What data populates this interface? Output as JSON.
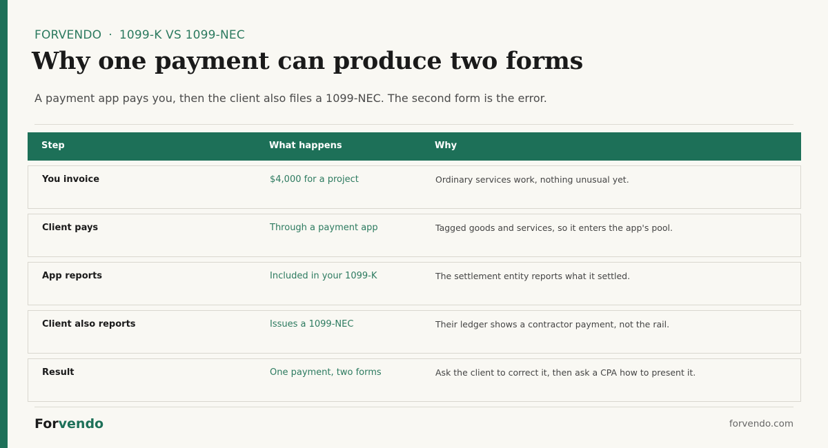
{
  "eyebrow": {
    "brand": "FORVENDO",
    "separator": "·",
    "topic": "1099-K VS 1099-NEC"
  },
  "title": "Why one payment can produce two forms",
  "subtitle": "A payment app pays you, then the client also files a 1099-NEC. The second form is the error.",
  "table": {
    "headers": [
      "Step",
      "What happens",
      "Why"
    ],
    "rows": [
      {
        "step": "You invoice",
        "what": "$4,000 for a project",
        "why": "Ordinary services work, nothing unusual yet."
      },
      {
        "step": "Client pays",
        "what": "Through a payment app",
        "why": "Tagged goods and services, so it enters the app's pool."
      },
      {
        "step": "App reports",
        "what": "Included in your 1099-K",
        "why": "The settlement entity reports what it settled."
      },
      {
        "step": "Client also reports",
        "what": "Issues a 1099-NEC",
        "why": "Their ledger shows a contractor payment, not the rail."
      },
      {
        "step": "Result",
        "what": "One payment, two forms",
        "why": "Ask the client to correct it, then ask a CPA how to present it."
      }
    ]
  },
  "footer": {
    "logo_part1": "For",
    "logo_part2": "vendo",
    "site": "forvendo.com"
  },
  "colors": {
    "accent": "#1d7058",
    "accent_text": "#2c7a5f",
    "background": "#f9f8f3"
  }
}
